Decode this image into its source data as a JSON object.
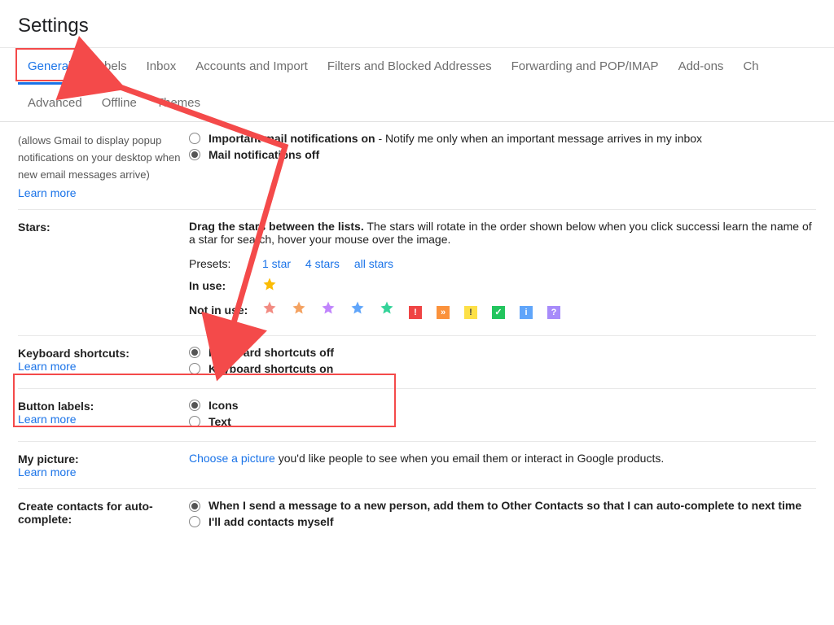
{
  "title": "Settings",
  "tabs": [
    "General",
    "Labels",
    "Inbox",
    "Accounts and Import",
    "Filters and Blocked Addresses",
    "Forwarding and POP/IMAP",
    "Add-ons",
    "Ch",
    "Advanced",
    "Offline",
    "Themes"
  ],
  "notifications": {
    "desc": "(allows Gmail to display popup notifications on your desktop when new email messages arrive)",
    "learn": "Learn more",
    "opt1_label": "Important mail notifications on",
    "opt1_extra": " - Notify me only when an important message arrives in my inbox",
    "opt2_label": "Mail notifications off"
  },
  "stars": {
    "label": "Stars:",
    "drag_bold": "Drag the stars between the lists.",
    "drag_rest": "  The stars will rotate in the order shown below when you click successi  learn the name of a star for search, hover your mouse over the image.",
    "presets_label": "Presets:",
    "preset_links": [
      "1 star",
      "4 stars",
      "all stars"
    ],
    "in_use": "In use:",
    "not_in_use": "Not in use:",
    "star_colors": [
      "#fbbc04"
    ],
    "not_star_colors": [
      "#f28b82",
      "#f4a261",
      "#c084fc",
      "#60a5fa",
      "#34d399"
    ],
    "squares": [
      {
        "bg": "#ef4444",
        "ch": "!"
      },
      {
        "bg": "#fb923c",
        "ch": "»"
      },
      {
        "bg": "#fde047",
        "ch": "!",
        "fg": "#444"
      },
      {
        "bg": "#22c55e",
        "ch": "✓"
      },
      {
        "bg": "#60a5fa",
        "ch": "i"
      },
      {
        "bg": "#a78bfa",
        "ch": "?"
      }
    ]
  },
  "keyboard": {
    "label": "Keyboard shortcuts:",
    "learn": "Learn more",
    "opt_off": "Keyboard shortcuts off",
    "opt_on": "Keyboard shortcuts on"
  },
  "buttons": {
    "label": "Button labels:",
    "learn": "Learn more",
    "opt_icons": "Icons",
    "opt_text": "Text"
  },
  "picture": {
    "label": "My picture:",
    "learn": "Learn more",
    "link": "Choose a picture",
    "rest": " you'd like people to see when you email them or interact in Google products."
  },
  "contacts": {
    "label": "Create contacts for auto-complete:",
    "opt1": "When I send a message to a new person, add them to Other Contacts so that I can auto-complete to next time",
    "opt2": "I'll add contacts myself"
  }
}
